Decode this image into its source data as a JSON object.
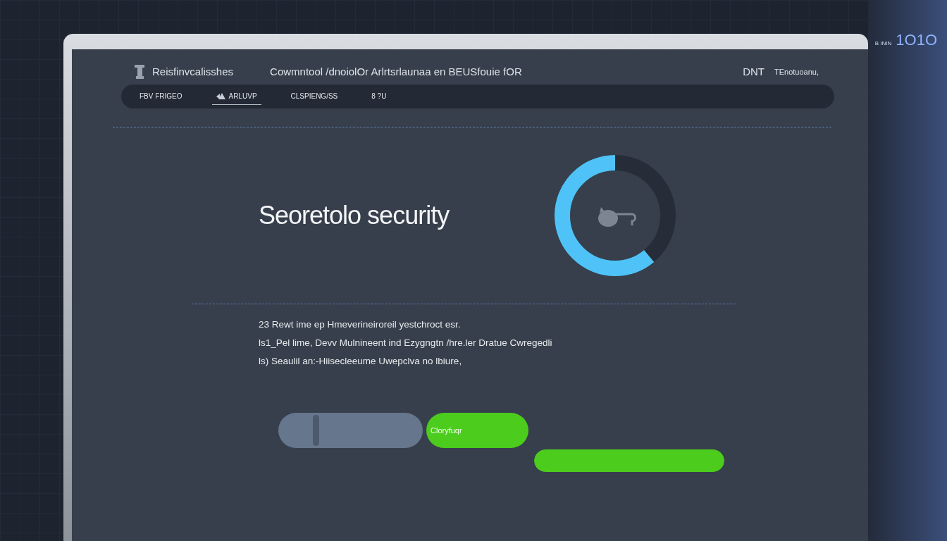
{
  "corner": {
    "label": "B ININ",
    "code": "1O1O"
  },
  "header": {
    "app_name": "Reisfinvcalisshes",
    "title": "Cowmntool /dnoiolOr Arlrtsrlaunaa en BEUSfouie fOR",
    "code": "DNT",
    "status": "TEnotuoanu,"
  },
  "tabs": [
    {
      "label": "FBV FRIGEO",
      "selected": false,
      "icon": false
    },
    {
      "label": "ARLUVP",
      "selected": true,
      "icon": true
    },
    {
      "label": "CLSPIENG/SS",
      "selected": false,
      "icon": false
    },
    {
      "label": "8 ?U",
      "selected": false,
      "icon": false
    }
  ],
  "heading": "Seoretolo security",
  "meter": {
    "level": 0.61
  },
  "lines": [
    "23 Rewt ime ep Hmeverineiroreil yestchroct esr.",
    "ls1_Pel lime, Devv Mulnineent ind Ezygngtn /hre.ler Dratue Cwregedli",
    "ls) Seaulil an:-Hiisecleeume Uwepclva no lbiure,"
  ],
  "controls": [
    {
      "kind": "slider",
      "level": 0.25
    },
    {
      "kind": "button",
      "label": "Cloryfuqr"
    },
    {
      "kind": "progress",
      "level": 1
    }
  ]
}
